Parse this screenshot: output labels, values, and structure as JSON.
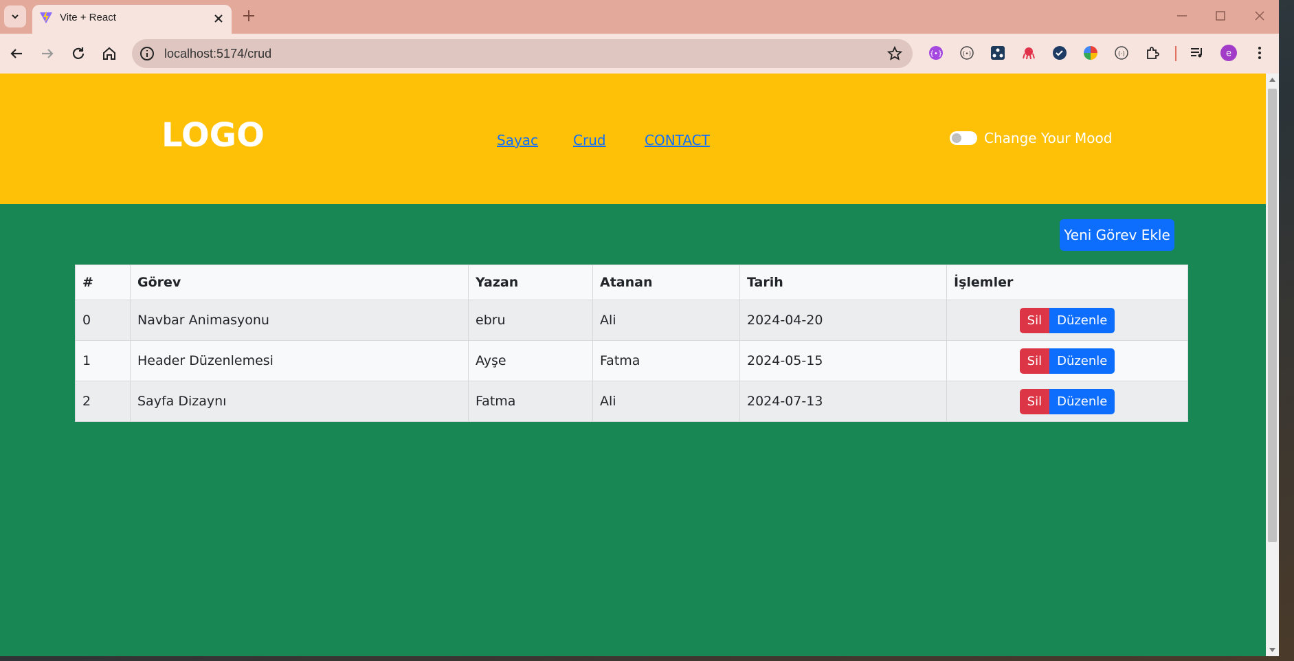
{
  "browser": {
    "tab_title": "Vite + React",
    "url": "localhost:5174/crud",
    "profile_initial": "e"
  },
  "navbar": {
    "logo": "LOGO",
    "links": [
      "Sayac",
      "Crud",
      "CONTACT"
    ],
    "mood_label": "Change Your Mood",
    "mood_on": false
  },
  "content": {
    "add_button": "Yeni Görev Ekle",
    "table": {
      "headers": [
        "#",
        "Görev",
        "Yazan",
        "Atanan",
        "Tarih",
        "İşlemler"
      ],
      "rows": [
        {
          "id": "0",
          "task": "Navbar Animasyonu",
          "author": "ebru",
          "assignee": "Ali",
          "date": "2024-04-20"
        },
        {
          "id": "1",
          "task": "Header Düzenlemesi",
          "author": "Ayşe",
          "assignee": "Fatma",
          "date": "2024-05-15"
        },
        {
          "id": "2",
          "task": "Sayfa Dizaynı",
          "author": "Fatma",
          "assignee": "Ali",
          "date": "2024-07-13"
        }
      ],
      "delete_label": "Sil",
      "edit_label": "Düzenle"
    }
  },
  "colors": {
    "navbar_bg": "#ffc107",
    "content_bg": "#198754",
    "primary": "#0d6efd",
    "danger": "#dc3545"
  }
}
